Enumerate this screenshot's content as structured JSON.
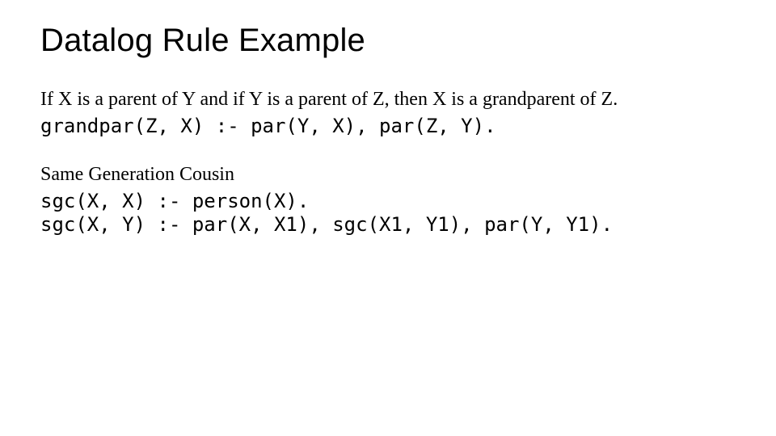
{
  "title": "Datalog Rule Example",
  "para1": "If X is a parent of Y and if Y is a parent of Z, then X is a grandparent of Z.",
  "code1": "grandpar(Z, X) :- par(Y, X), par(Z, Y).",
  "para2": "Same Generation Cousin",
  "code2": "sgc(X, X) :- person(X).",
  "code3": "sgc(X, Y) :- par(X, X1), sgc(X1, Y1), par(Y, Y1)."
}
